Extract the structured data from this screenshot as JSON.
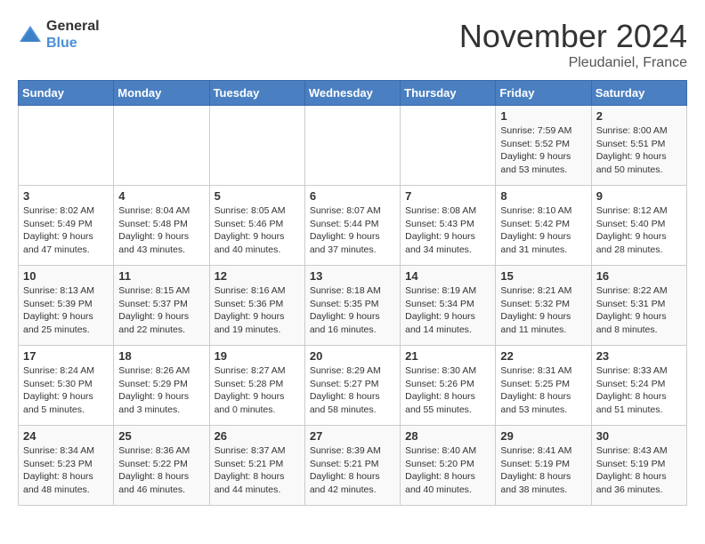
{
  "logo": {
    "text_general": "General",
    "text_blue": "Blue"
  },
  "header": {
    "month": "November 2024",
    "location": "Pleudaniel, France"
  },
  "weekdays": [
    "Sunday",
    "Monday",
    "Tuesday",
    "Wednesday",
    "Thursday",
    "Friday",
    "Saturday"
  ],
  "weeks": [
    [
      {
        "day": "",
        "sunrise": "",
        "sunset": "",
        "daylight": ""
      },
      {
        "day": "",
        "sunrise": "",
        "sunset": "",
        "daylight": ""
      },
      {
        "day": "",
        "sunrise": "",
        "sunset": "",
        "daylight": ""
      },
      {
        "day": "",
        "sunrise": "",
        "sunset": "",
        "daylight": ""
      },
      {
        "day": "",
        "sunrise": "",
        "sunset": "",
        "daylight": ""
      },
      {
        "day": "1",
        "sunrise": "Sunrise: 7:59 AM",
        "sunset": "Sunset: 5:52 PM",
        "daylight": "Daylight: 9 hours and 53 minutes."
      },
      {
        "day": "2",
        "sunrise": "Sunrise: 8:00 AM",
        "sunset": "Sunset: 5:51 PM",
        "daylight": "Daylight: 9 hours and 50 minutes."
      }
    ],
    [
      {
        "day": "3",
        "sunrise": "Sunrise: 8:02 AM",
        "sunset": "Sunset: 5:49 PM",
        "daylight": "Daylight: 9 hours and 47 minutes."
      },
      {
        "day": "4",
        "sunrise": "Sunrise: 8:04 AM",
        "sunset": "Sunset: 5:48 PM",
        "daylight": "Daylight: 9 hours and 43 minutes."
      },
      {
        "day": "5",
        "sunrise": "Sunrise: 8:05 AM",
        "sunset": "Sunset: 5:46 PM",
        "daylight": "Daylight: 9 hours and 40 minutes."
      },
      {
        "day": "6",
        "sunrise": "Sunrise: 8:07 AM",
        "sunset": "Sunset: 5:44 PM",
        "daylight": "Daylight: 9 hours and 37 minutes."
      },
      {
        "day": "7",
        "sunrise": "Sunrise: 8:08 AM",
        "sunset": "Sunset: 5:43 PM",
        "daylight": "Daylight: 9 hours and 34 minutes."
      },
      {
        "day": "8",
        "sunrise": "Sunrise: 8:10 AM",
        "sunset": "Sunset: 5:42 PM",
        "daylight": "Daylight: 9 hours and 31 minutes."
      },
      {
        "day": "9",
        "sunrise": "Sunrise: 8:12 AM",
        "sunset": "Sunset: 5:40 PM",
        "daylight": "Daylight: 9 hours and 28 minutes."
      }
    ],
    [
      {
        "day": "10",
        "sunrise": "Sunrise: 8:13 AM",
        "sunset": "Sunset: 5:39 PM",
        "daylight": "Daylight: 9 hours and 25 minutes."
      },
      {
        "day": "11",
        "sunrise": "Sunrise: 8:15 AM",
        "sunset": "Sunset: 5:37 PM",
        "daylight": "Daylight: 9 hours and 22 minutes."
      },
      {
        "day": "12",
        "sunrise": "Sunrise: 8:16 AM",
        "sunset": "Sunset: 5:36 PM",
        "daylight": "Daylight: 9 hours and 19 minutes."
      },
      {
        "day": "13",
        "sunrise": "Sunrise: 8:18 AM",
        "sunset": "Sunset: 5:35 PM",
        "daylight": "Daylight: 9 hours and 16 minutes."
      },
      {
        "day": "14",
        "sunrise": "Sunrise: 8:19 AM",
        "sunset": "Sunset: 5:34 PM",
        "daylight": "Daylight: 9 hours and 14 minutes."
      },
      {
        "day": "15",
        "sunrise": "Sunrise: 8:21 AM",
        "sunset": "Sunset: 5:32 PM",
        "daylight": "Daylight: 9 hours and 11 minutes."
      },
      {
        "day": "16",
        "sunrise": "Sunrise: 8:22 AM",
        "sunset": "Sunset: 5:31 PM",
        "daylight": "Daylight: 9 hours and 8 minutes."
      }
    ],
    [
      {
        "day": "17",
        "sunrise": "Sunrise: 8:24 AM",
        "sunset": "Sunset: 5:30 PM",
        "daylight": "Daylight: 9 hours and 5 minutes."
      },
      {
        "day": "18",
        "sunrise": "Sunrise: 8:26 AM",
        "sunset": "Sunset: 5:29 PM",
        "daylight": "Daylight: 9 hours and 3 minutes."
      },
      {
        "day": "19",
        "sunrise": "Sunrise: 8:27 AM",
        "sunset": "Sunset: 5:28 PM",
        "daylight": "Daylight: 9 hours and 0 minutes."
      },
      {
        "day": "20",
        "sunrise": "Sunrise: 8:29 AM",
        "sunset": "Sunset: 5:27 PM",
        "daylight": "Daylight: 8 hours and 58 minutes."
      },
      {
        "day": "21",
        "sunrise": "Sunrise: 8:30 AM",
        "sunset": "Sunset: 5:26 PM",
        "daylight": "Daylight: 8 hours and 55 minutes."
      },
      {
        "day": "22",
        "sunrise": "Sunrise: 8:31 AM",
        "sunset": "Sunset: 5:25 PM",
        "daylight": "Daylight: 8 hours and 53 minutes."
      },
      {
        "day": "23",
        "sunrise": "Sunrise: 8:33 AM",
        "sunset": "Sunset: 5:24 PM",
        "daylight": "Daylight: 8 hours and 51 minutes."
      }
    ],
    [
      {
        "day": "24",
        "sunrise": "Sunrise: 8:34 AM",
        "sunset": "Sunset: 5:23 PM",
        "daylight": "Daylight: 8 hours and 48 minutes."
      },
      {
        "day": "25",
        "sunrise": "Sunrise: 8:36 AM",
        "sunset": "Sunset: 5:22 PM",
        "daylight": "Daylight: 8 hours and 46 minutes."
      },
      {
        "day": "26",
        "sunrise": "Sunrise: 8:37 AM",
        "sunset": "Sunset: 5:21 PM",
        "daylight": "Daylight: 8 hours and 44 minutes."
      },
      {
        "day": "27",
        "sunrise": "Sunrise: 8:39 AM",
        "sunset": "Sunset: 5:21 PM",
        "daylight": "Daylight: 8 hours and 42 minutes."
      },
      {
        "day": "28",
        "sunrise": "Sunrise: 8:40 AM",
        "sunset": "Sunset: 5:20 PM",
        "daylight": "Daylight: 8 hours and 40 minutes."
      },
      {
        "day": "29",
        "sunrise": "Sunrise: 8:41 AM",
        "sunset": "Sunset: 5:19 PM",
        "daylight": "Daylight: 8 hours and 38 minutes."
      },
      {
        "day": "30",
        "sunrise": "Sunrise: 8:43 AM",
        "sunset": "Sunset: 5:19 PM",
        "daylight": "Daylight: 8 hours and 36 minutes."
      }
    ]
  ]
}
